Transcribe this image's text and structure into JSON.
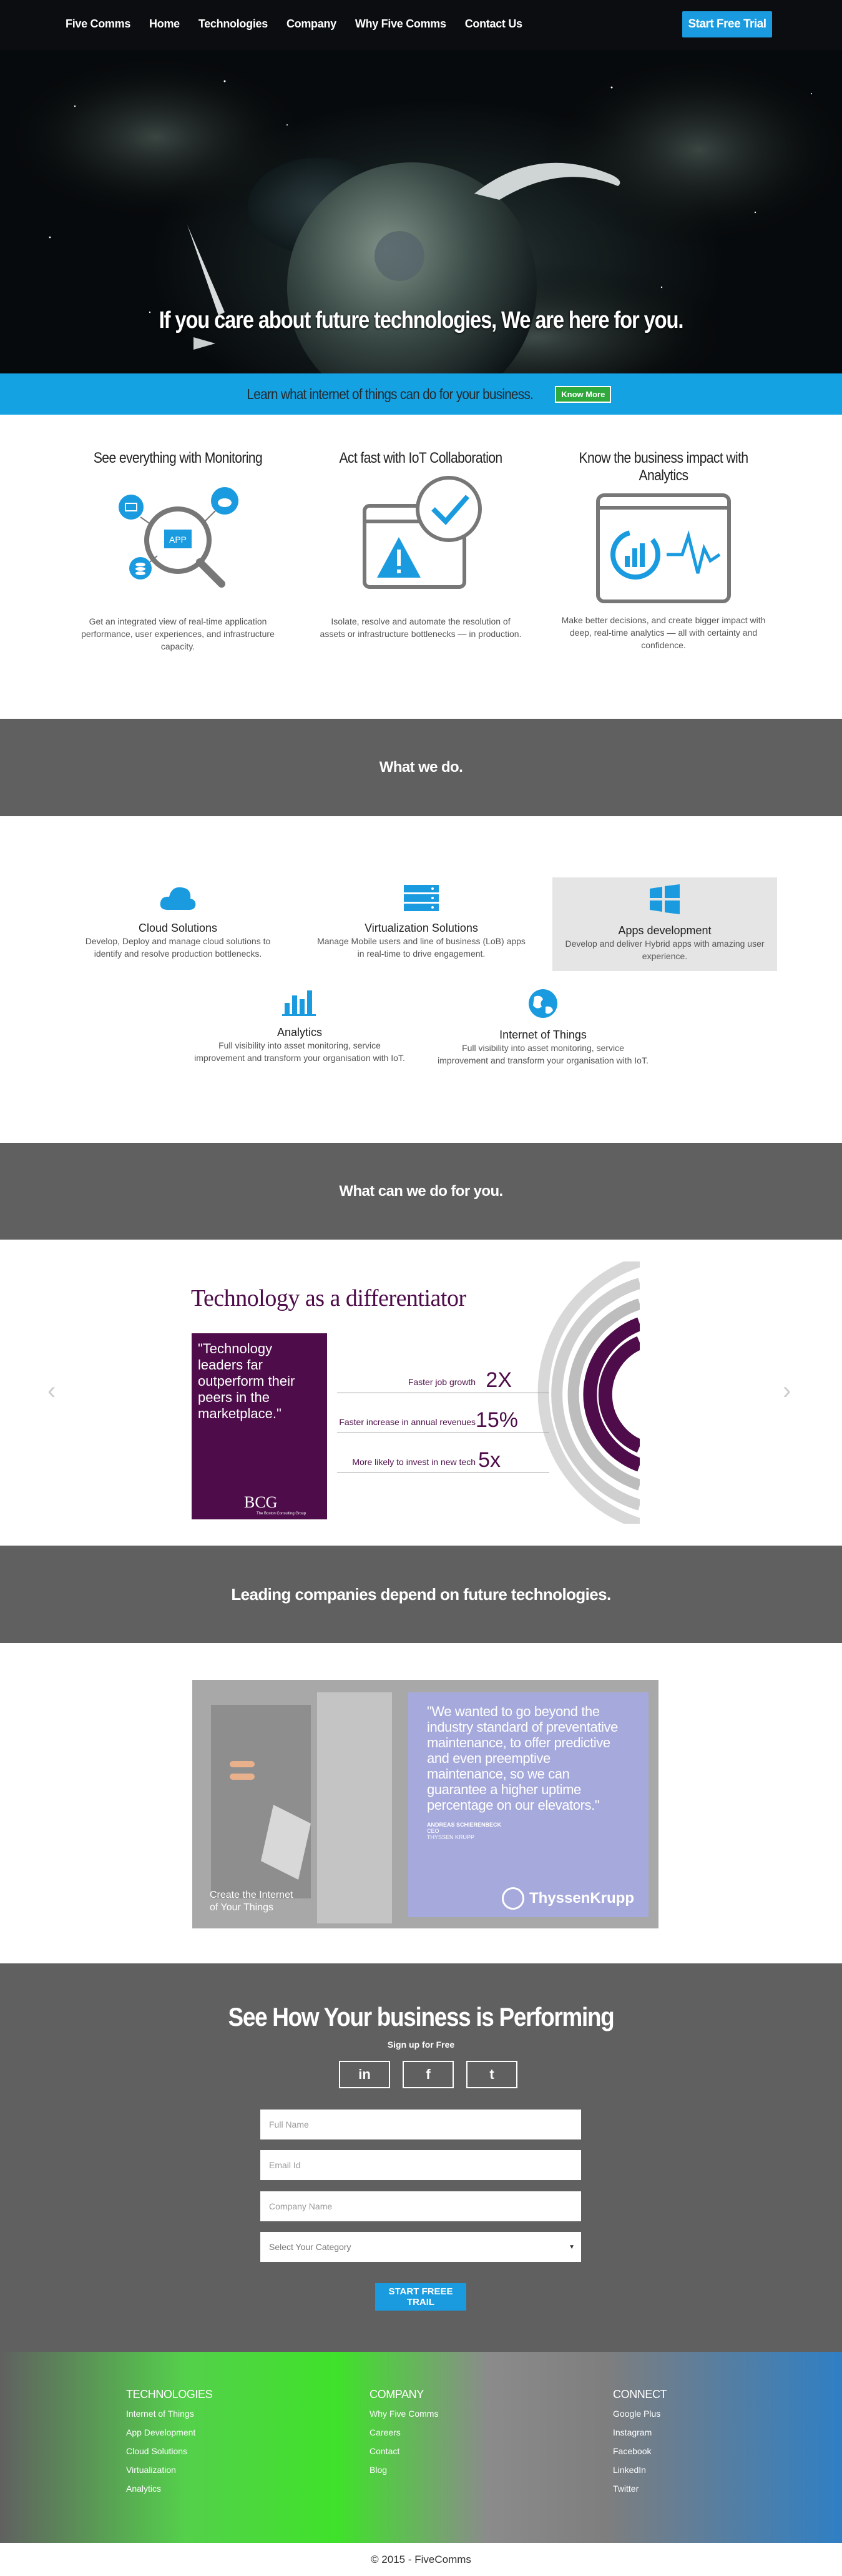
{
  "nav": {
    "items": [
      "Five Comms",
      "Home",
      "Technologies",
      "Company",
      "Why Five Comms",
      "Contact Us"
    ],
    "cta": "Start Free Trial"
  },
  "hero": {
    "headline": "If you care about future technologies, We are here for you."
  },
  "band": {
    "text": "Learn what internet of things can do for your business.",
    "button": "Know More"
  },
  "features": [
    {
      "title": "See everything with Monitoring",
      "text": "Get an integrated view of real-time application performance, user experiences, and infrastructure capacity.",
      "badge": "APP"
    },
    {
      "title": "Act fast with IoT Collaboration",
      "text": "Isolate, resolve and automate the resolution of assets or infrastructure bottlenecks — in production."
    },
    {
      "title": "Know the business impact with Analytics",
      "text": "Make better decisions, and create bigger impact with deep, real-time analytics — all with certainty and confidence."
    }
  ],
  "what_we_do": {
    "title": "What we do."
  },
  "services": [
    {
      "title": "Cloud Solutions",
      "text": "Develop, Deploy and manage cloud solutions to identify and resolve production bottlenecks."
    },
    {
      "title": "Virtualization Solutions",
      "text": "Manage Mobile users and line of business (LoB) apps in real-time to drive engagement."
    },
    {
      "title": "Apps development",
      "text": "Develop and deliver Hybrid apps with amazing user experience."
    },
    {
      "title": "Analytics",
      "text": "Full visibility into asset monitoring, service improvement and transform your organisation with IoT."
    },
    {
      "title": "Internet of Things",
      "text": "Full visibility into asset monitoring, service improvement and transform your organisation with IoT."
    }
  ],
  "what_can": {
    "title": "What can we do for you."
  },
  "slide": {
    "title": "Technology as a differentiator",
    "quote": "\"Technology leaders far outperform their peers in the marketplace.\"",
    "logo": "BCG",
    "logo_sub": "The Boston Consulting Group",
    "stats": [
      {
        "label": "Faster job growth",
        "value": "2X"
      },
      {
        "label": "Faster increase in annual revenues",
        "value": "15%"
      },
      {
        "label": "More likely to invest in new tech",
        "value": "5x"
      }
    ],
    "prev": "‹",
    "next": "›"
  },
  "leading": {
    "title": "Leading companies depend on future technologies."
  },
  "testimonial": {
    "quote": "\"We wanted to go beyond the industry standard of preventative maintenance, to offer predictive and even preemptive maintenance, so we can guarantee a higher uptime percentage on our elevators.\"",
    "name": "ANDREAS SCHIERENBECK",
    "role": "CEO",
    "company": "THYSSEN KRUPP",
    "brand": "ThyssenKrupp",
    "caption": "Create the Internet of Your Things"
  },
  "signup": {
    "title": "See How Your business is Performing",
    "subtitle": "Sign up for Free",
    "social": [
      "in",
      "f",
      "t"
    ],
    "fields": [
      "Full Name",
      "Email Id",
      "Company Name"
    ],
    "select": "Select Your Category",
    "submit": "START FREEE TRAIL"
  },
  "footer": {
    "columns": [
      {
        "title": "TECHNOLOGIES",
        "links": [
          "Internet of Things",
          "App Development",
          "Cloud Solutions",
          "Virtualization",
          "Analytics"
        ]
      },
      {
        "title": "COMPANY",
        "links": [
          "Why Five Comms",
          "Careers",
          "Contact",
          "Blog"
        ]
      },
      {
        "title": "CONNECT",
        "links": [
          "Google Plus",
          "Instagram",
          "Facebook",
          "LinkedIn",
          "Twitter"
        ]
      }
    ],
    "copyright": "© 2015 - FiveComms"
  },
  "colors": {
    "accent": "#1a9bdf",
    "gray_band": "#606060",
    "purple": "#4e0d4a",
    "green_btn": "#2fa83c"
  }
}
